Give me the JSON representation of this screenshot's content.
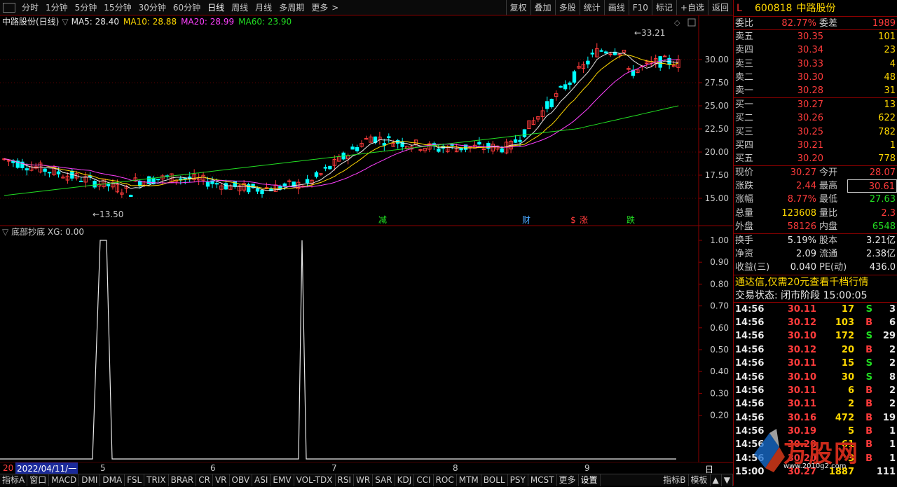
{
  "toolbar": {
    "periods": [
      "分时",
      "1分钟",
      "5分钟",
      "15分钟",
      "30分钟",
      "60分钟",
      "日线",
      "周线",
      "月线",
      "多周期",
      "更多"
    ],
    "active_period": "日线",
    "tools": [
      "复权",
      "叠加",
      "多股",
      "统计",
      "画线",
      "F10",
      "标记",
      "+自选",
      "返回"
    ]
  },
  "main_chart": {
    "title": "中路股份(日线)",
    "ma": [
      {
        "label": "MA5: 28.40",
        "color": "#e8e8e8"
      },
      {
        "label": "MA10: 28.88",
        "color": "#ffd800"
      },
      {
        "label": "MA20: 28.99",
        "color": "#ff40ff"
      },
      {
        "label": "MA60: 23.90",
        "color": "#22dd22"
      }
    ],
    "y_ticks": [
      "30.00",
      "27.50",
      "25.00",
      "22.50",
      "20.00",
      "17.50",
      "15.00"
    ],
    "high_label": "33.21",
    "low_label": "13.50",
    "markers": [
      {
        "text": "减",
        "color": "#22dd22"
      },
      {
        "text": "财",
        "color": "#4aa8ff"
      },
      {
        "text": "$",
        "color": "#ff3b3b"
      },
      {
        "text": "涨",
        "color": "#ff3b3b"
      },
      {
        "text": "跌",
        "color": "#22dd22"
      }
    ]
  },
  "sub_chart": {
    "title": "底部抄底 XG: 0.00",
    "y_ticks": [
      "1.00",
      "0.90",
      "0.80",
      "0.70",
      "0.60",
      "0.50",
      "0.40",
      "0.30",
      "0.20"
    ]
  },
  "date_axis": {
    "start": "20",
    "cursor_date": "2022/04/11/一",
    "months": [
      "5",
      "6",
      "7",
      "8",
      "9"
    ],
    "right_label": "日线"
  },
  "bottom_tabs": [
    "指标A",
    "窗口",
    "MACD",
    "DMI",
    "DMA",
    "FSL",
    "TRIX",
    "BRAR",
    "CR",
    "VR",
    "OBV",
    "ASI",
    "EMV",
    "VOL-TDX",
    "RSI",
    "WR",
    "SAR",
    "KDJ",
    "CCI",
    "ROC",
    "MTM",
    "BOLL",
    "PSY",
    "MCST",
    "更多",
    "设置",
    "指标B",
    "模板"
  ],
  "bottom_icons": [
    "▲",
    "▼"
  ],
  "chart_data": {
    "type": "line",
    "title": "底部抄底 XG: 0.00",
    "series": [
      {
        "name": "XG",
        "values": [
          0,
          0,
          1,
          1,
          0,
          0,
          0,
          1,
          0,
          0,
          0
        ]
      }
    ],
    "ylim": [
      0,
      1.0
    ]
  },
  "quote": {
    "code": "600818",
    "name": "中路股份",
    "mark": "L",
    "weibi_label": "委比",
    "weibi": "82.77%",
    "weicha_label": "委差",
    "weicha": "1989",
    "asks": [
      {
        "label": "卖五",
        "price": "30.35",
        "vol": "101"
      },
      {
        "label": "卖四",
        "price": "30.34",
        "vol": "23"
      },
      {
        "label": "卖三",
        "price": "30.33",
        "vol": "4"
      },
      {
        "label": "卖二",
        "price": "30.30",
        "vol": "48"
      },
      {
        "label": "卖一",
        "price": "30.28",
        "vol": "31"
      }
    ],
    "bids": [
      {
        "label": "买一",
        "price": "30.27",
        "vol": "13"
      },
      {
        "label": "买二",
        "price": "30.26",
        "vol": "622"
      },
      {
        "label": "买三",
        "price": "30.25",
        "vol": "782"
      },
      {
        "label": "买四",
        "price": "30.21",
        "vol": "1"
      },
      {
        "label": "买五",
        "price": "30.20",
        "vol": "778"
      }
    ],
    "stats": [
      {
        "l1": "现价",
        "v1": "30.27",
        "c1": "red",
        "l2": "今开",
        "v2": "28.07",
        "c2": "red"
      },
      {
        "l1": "涨跌",
        "v1": "2.44",
        "c1": "red",
        "l2": "最高",
        "v2": "30.61",
        "c2": "red"
      },
      {
        "l1": "涨幅",
        "v1": "8.77%",
        "c1": "red",
        "l2": "最低",
        "v2": "27.63",
        "c2": "green"
      },
      {
        "l1": "总量",
        "v1": "123608",
        "c1": "yellow",
        "l2": "量比",
        "v2": "2.3",
        "c2": "red"
      },
      {
        "l1": "外盘",
        "v1": "58126",
        "c1": "red",
        "l2": "内盘",
        "v2": "6548",
        "c2": "green"
      }
    ],
    "stats2": [
      {
        "l1": "换手",
        "v1": "5.19%",
        "l2": "股本",
        "v2": "3.21亿"
      },
      {
        "l1": "净资",
        "v1": "2.09",
        "l2": "流通",
        "v2": "2.38亿"
      },
      {
        "l1": "收益(三)",
        "v1": "0.040",
        "l2": "PE(动)",
        "v2": "436.0"
      }
    ],
    "ad_text": "通达信,仅需20元查看千档行情",
    "state_text": "交易状态: 闭市阶段 15:00:05",
    "ticks": [
      {
        "t": "14:56",
        "p": "30.11",
        "v": "17",
        "bs": "S",
        "n": "3"
      },
      {
        "t": "14:56",
        "p": "30.12",
        "v": "103",
        "bs": "B",
        "n": "6"
      },
      {
        "t": "14:56",
        "p": "30.10",
        "v": "172",
        "bs": "S",
        "n": "29"
      },
      {
        "t": "14:56",
        "p": "30.12",
        "v": "20",
        "bs": "B",
        "n": "2"
      },
      {
        "t": "14:56",
        "p": "30.11",
        "v": "15",
        "bs": "S",
        "n": "2"
      },
      {
        "t": "14:56",
        "p": "30.10",
        "v": "30",
        "bs": "S",
        "n": "8"
      },
      {
        "t": "14:56",
        "p": "30.11",
        "v": "6",
        "bs": "B",
        "n": "2"
      },
      {
        "t": "14:56",
        "p": "30.11",
        "v": "2",
        "bs": "B",
        "n": "2"
      },
      {
        "t": "14:56",
        "p": "30.16",
        "v": "472",
        "bs": "B",
        "n": "19"
      },
      {
        "t": "14:56",
        "p": "30.19",
        "v": "5",
        "bs": "B",
        "n": "1"
      },
      {
        "t": "14:56",
        "p": "30.20",
        "v": "61",
        "bs": "B",
        "n": "1"
      },
      {
        "t": "14:56",
        "p": "30.20",
        "v": "3",
        "bs": "B",
        "n": "1"
      },
      {
        "t": "15:00",
        "p": "30.27",
        "v": "1887",
        "bs": "",
        "n": "111"
      }
    ],
    "watermark": "万股网",
    "watermark_url": "www.2010g2.com"
  }
}
